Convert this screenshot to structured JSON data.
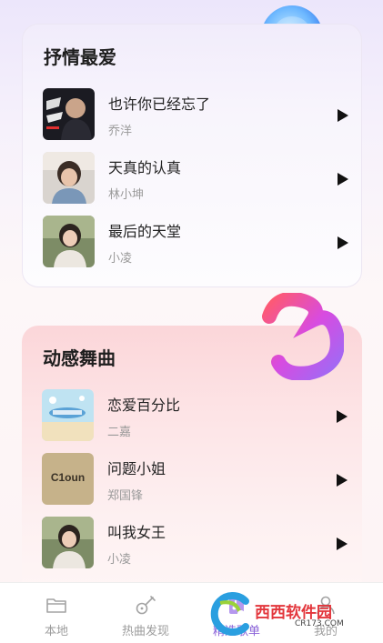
{
  "sections": [
    {
      "title": "抒情最爱",
      "songs": [
        {
          "title": "也许你已经忘了",
          "artist": "乔洋"
        },
        {
          "title": "天真的认真",
          "artist": "林小坤"
        },
        {
          "title": "最后的天堂",
          "artist": "小凌"
        }
      ]
    },
    {
      "title": "动感舞曲",
      "songs": [
        {
          "title": "恋爱百分比",
          "artist": "二嘉"
        },
        {
          "title": "问题小姐",
          "artist": "郑国锋"
        },
        {
          "title": "叫我女王",
          "artist": "小凌"
        }
      ]
    }
  ],
  "covers": {
    "cover_1_text": "乔洋",
    "cover_5_text": "C1oun"
  },
  "tabs": [
    {
      "label": "本地",
      "icon": "folder-icon"
    },
    {
      "label": "热曲发现",
      "icon": "guitar-icon"
    },
    {
      "label": "精选歌单",
      "icon": "playlist-icon"
    },
    {
      "label": "我的",
      "icon": "user-icon"
    }
  ],
  "watermark": {
    "text": "西西软件园",
    "sub": "CR173.COM"
  },
  "colors": {
    "accent": "#8a62d8",
    "card_2_bg": "#fbd6d9",
    "play": "#111111"
  }
}
